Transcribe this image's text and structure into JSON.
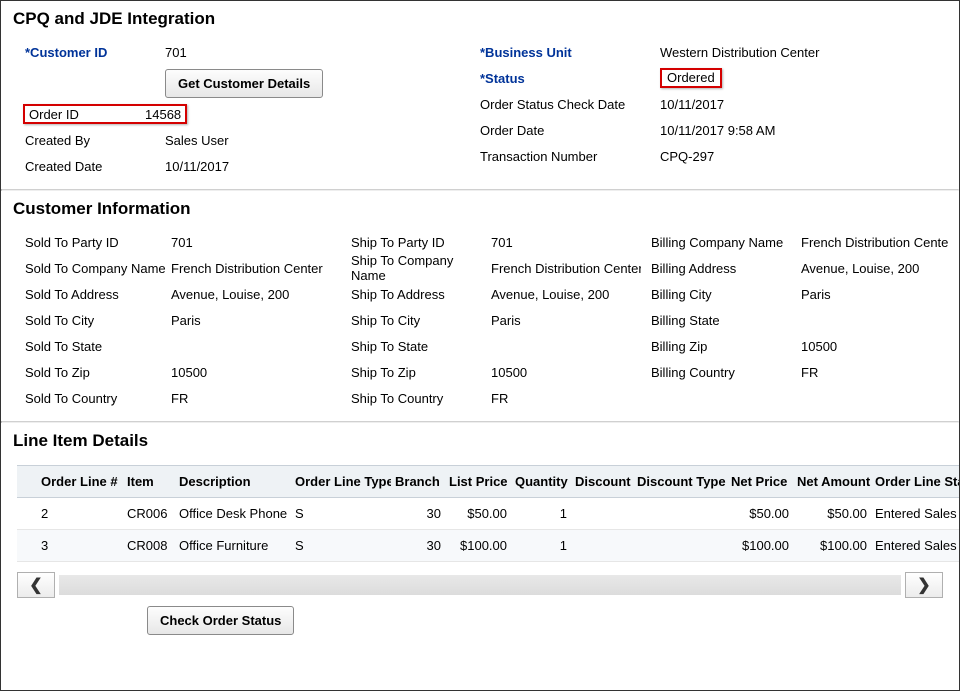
{
  "header": {
    "title": "CPQ and JDE Integration"
  },
  "top": {
    "left": {
      "customer_id_label": "*Customer ID",
      "customer_id_value": "701",
      "get_customer_button": "Get Customer Details",
      "order_id_label": "Order ID",
      "order_id_value": "14568",
      "created_by_label": "Created By",
      "created_by_value": "Sales User",
      "created_date_label": "Created Date",
      "created_date_value": "10/11/2017"
    },
    "right": {
      "business_unit_label": "*Business Unit",
      "business_unit_value": "Western Distribution Center",
      "status_label": "*Status",
      "status_value": "Ordered",
      "status_check_label": "Order Status Check Date",
      "status_check_value": "10/11/2017",
      "order_date_label": "Order Date",
      "order_date_value": "10/11/2017 9:58 AM",
      "tx_label": "Transaction Number",
      "tx_value": "CPQ-297"
    }
  },
  "customer": {
    "title": "Customer Information",
    "labels": {
      "sold_party_id": "Sold To Party ID",
      "sold_company": "Sold To Company Name",
      "sold_addr": "Sold To Address",
      "sold_city": "Sold To City",
      "sold_state": "Sold To State",
      "sold_zip": "Sold To Zip",
      "sold_country": "Sold To Country",
      "ship_party_id": "Ship To Party ID",
      "ship_company": "Ship To Company Name",
      "ship_addr": "Ship To Address",
      "ship_city": "Ship To City",
      "ship_state": "Ship To State",
      "ship_zip": "Ship To Zip",
      "ship_country": "Ship To Country",
      "bill_company": "Billing Company Name",
      "bill_addr": "Billing Address",
      "bill_city": "Billing City",
      "bill_state": "Billing State",
      "bill_zip": "Billing Zip",
      "bill_country": "Billing Country"
    },
    "values": {
      "sold_party_id": "701",
      "sold_company": "French Distribution Center",
      "sold_addr": "Avenue, Louise, 200",
      "sold_city": "Paris",
      "sold_state": "",
      "sold_zip": "10500",
      "sold_country": "FR",
      "ship_party_id": "701",
      "ship_company": "French Distribution Center",
      "ship_addr": "Avenue, Louise, 200",
      "ship_city": "Paris",
      "ship_state": "",
      "ship_zip": "10500",
      "ship_country": "FR",
      "bill_company": "French Distribution Center",
      "bill_addr": "Avenue, Louise, 200",
      "bill_city": "Paris",
      "bill_state": "",
      "bill_zip": "10500",
      "bill_country": "FR"
    }
  },
  "line_items": {
    "title": "Line Item Details",
    "headers": {
      "order_line": "Order Line #",
      "item": "Item",
      "description": "Description",
      "order_line_type": "Order Line Type",
      "branch": "Branch",
      "list_price": "List Price",
      "quantity": "Quantity",
      "discount": "Discount",
      "discount_type": "Discount Type",
      "net_price": "Net Price",
      "net_amount": "Net Amount",
      "order_line_status": "Order Line Status"
    },
    "rows": [
      {
        "line": "2",
        "item": "CR006",
        "desc": "Office Desk Phone",
        "type": "S",
        "branch": "30",
        "list": "$50.00",
        "qty": "1",
        "disc": "",
        "dtype": "",
        "netp": "$50.00",
        "neta": "$50.00",
        "status": "Entered Sales Order"
      },
      {
        "line": "3",
        "item": "CR008",
        "desc": "Office Furniture",
        "type": "S",
        "branch": "30",
        "list": "$100.00",
        "qty": "1",
        "disc": "",
        "dtype": "",
        "netp": "$100.00",
        "neta": "$100.00",
        "status": "Entered Sales Order"
      }
    ]
  },
  "footer": {
    "check_status_button": "Check Order Status"
  }
}
